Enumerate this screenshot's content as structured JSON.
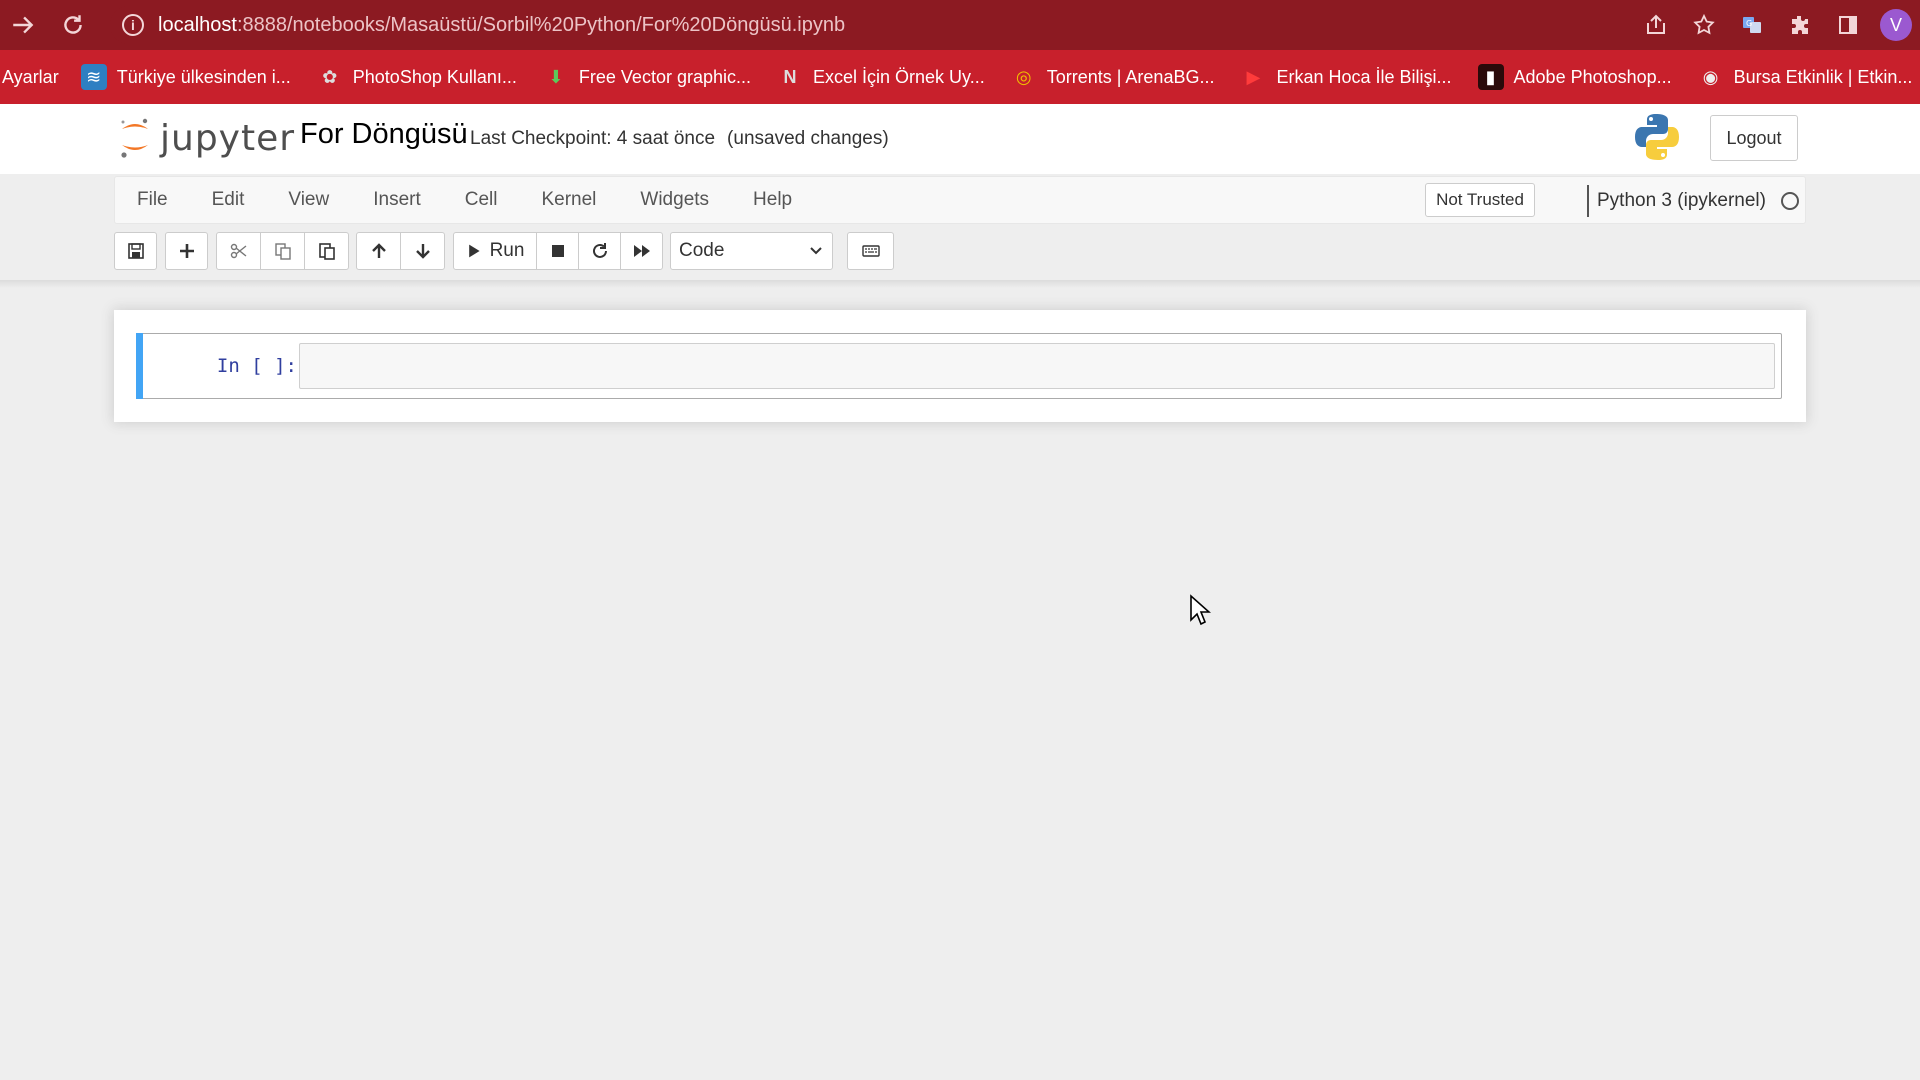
{
  "browser": {
    "url_host": "localhost",
    "url_path": ":8888/notebooks/Masaüstü/Sorbil%20Python/For%20Döngüsü.ipynb",
    "avatar_letter": "V",
    "bookmarks": [
      {
        "label": "Ayarlar",
        "icon": "none"
      },
      {
        "label": "Türkiye ülkesinden i...",
        "icon": "wave-icon"
      },
      {
        "label": "PhotoShop Kullanı...",
        "icon": "ps-icon"
      },
      {
        "label": "Free Vector graphic...",
        "icon": "download-arrow-icon"
      },
      {
        "label": "Excel İçin Örnek Uy...",
        "icon": "excel-icon"
      },
      {
        "label": "Torrents | ArenaBG...",
        "icon": "target-icon"
      },
      {
        "label": "Erkan Hoca İle Bilişi...",
        "icon": "youtube-icon"
      },
      {
        "label": "Adobe Photoshop...",
        "icon": "photoshop-icon"
      },
      {
        "label": "Bursa Etkinlik | Etkin...",
        "icon": "globe-icon"
      }
    ]
  },
  "jupyter": {
    "logo_text": "jupyter",
    "notebook_name": "For Döngüsü",
    "checkpoint": "Last Checkpoint: 4 saat önce",
    "unsaved": "(unsaved changes)",
    "logout_label": "Logout"
  },
  "menubar": {
    "items": [
      "File",
      "Edit",
      "View",
      "Insert",
      "Cell",
      "Kernel",
      "Widgets",
      "Help"
    ],
    "trust_label": "Not Trusted",
    "kernel_label": "Python 3 (ipykernel)"
  },
  "toolbar": {
    "run_label": "Run",
    "cell_type": "Code",
    "cell_type_options": [
      "Code"
    ]
  },
  "cell": {
    "prompt": "In [ ]:",
    "source": ""
  },
  "colors": {
    "chrome_dark": "#8c1a22",
    "bookmarks_bar": "#c8202c",
    "cell_selected_bar": "#42a5f5",
    "prompt_color": "#303f9f"
  }
}
